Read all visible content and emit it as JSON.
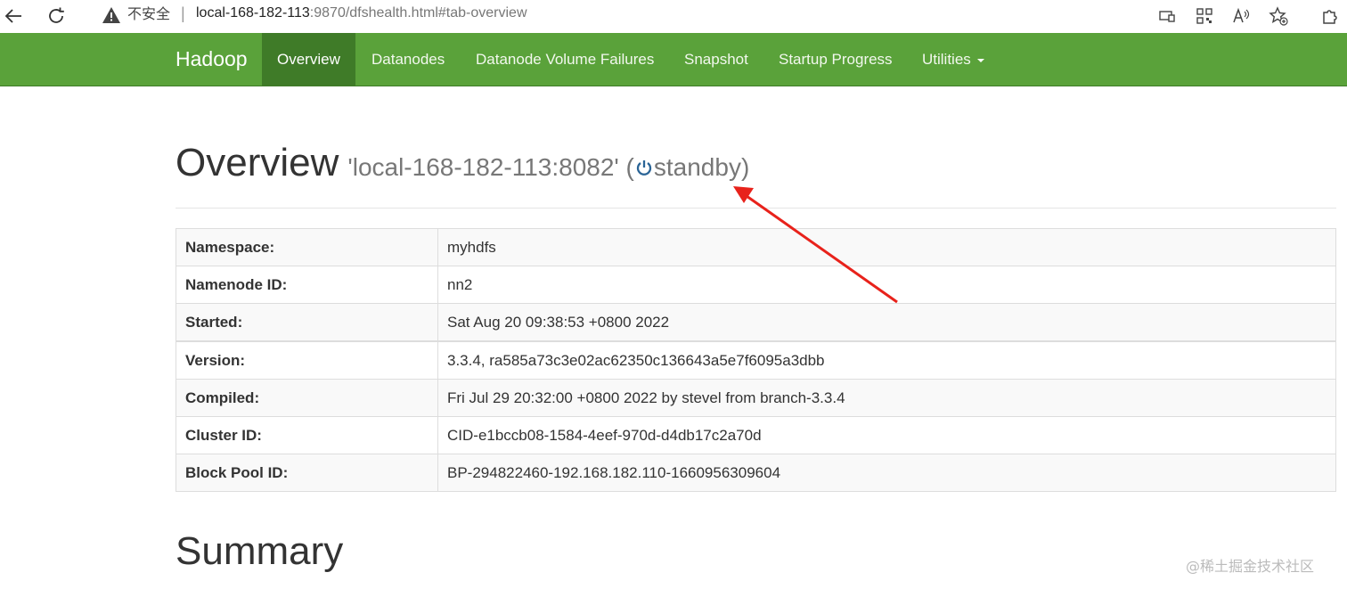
{
  "browser": {
    "security_label": "不安全",
    "separator": "|",
    "url_host": "local-168-182-113",
    "url_rest": ":9870/dfshealth.html#tab-overview"
  },
  "navbar": {
    "brand": "Hadoop",
    "items": [
      {
        "label": "Overview",
        "active": true
      },
      {
        "label": "Datanodes"
      },
      {
        "label": "Datanode Volume Failures"
      },
      {
        "label": "Snapshot"
      },
      {
        "label": "Startup Progress"
      },
      {
        "label": "Utilities"
      }
    ],
    "accent": "#5aa23a",
    "active_bg": "#3f7b28"
  },
  "header": {
    "title": "Overview",
    "subtitle_pre": "'local-168-182-113:8082' (",
    "state": "standby",
    "subtitle_post": ")"
  },
  "overview_table": [
    {
      "key": "Namespace:",
      "value": "myhdfs"
    },
    {
      "key": "Namenode ID:",
      "value": "nn2"
    },
    {
      "key": "Started:",
      "value": "Sat Aug 20 09:38:53 +0800 2022"
    },
    {
      "key": "Version:",
      "value": "3.3.4, ra585a73c3e02ac62350c136643a5e7f6095a3dbb"
    },
    {
      "key": "Compiled:",
      "value": "Fri Jul 29 20:32:00 +0800 2022 by stevel from branch-3.3.4"
    },
    {
      "key": "Cluster ID:",
      "value": "CID-e1bccb08-1584-4eef-970d-d4db17c2a70d"
    },
    {
      "key": "Block Pool ID:",
      "value": "BP-294822460-192.168.182.110-1660956309604"
    }
  ],
  "summary_title": "Summary",
  "watermark": "@稀土掘金技术社区",
  "annotation_arrow_color": "#e8221b"
}
